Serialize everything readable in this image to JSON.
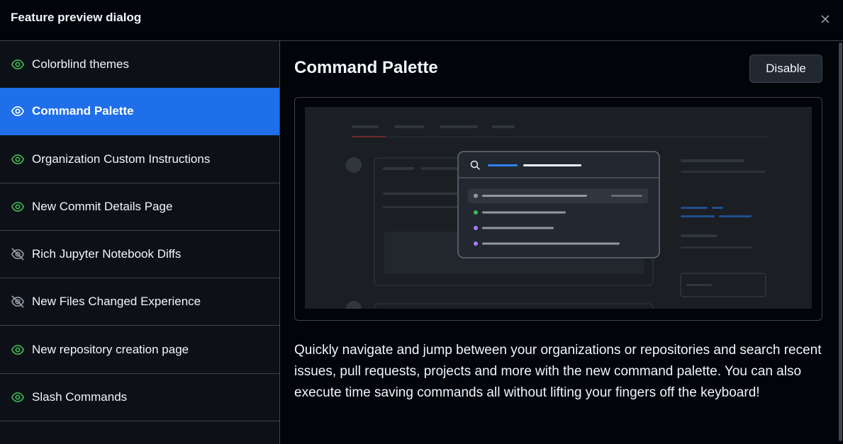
{
  "dialog": {
    "title": "Feature preview dialog",
    "close_icon": "x-icon"
  },
  "sidebar": {
    "items": [
      {
        "label": "Colorblind themes",
        "icon": "eye-icon",
        "enabled": true,
        "active": false
      },
      {
        "label": "Command Palette",
        "icon": "eye-icon",
        "enabled": true,
        "active": true
      },
      {
        "label": "Organization Custom Instructions",
        "icon": "eye-icon",
        "enabled": true,
        "active": false
      },
      {
        "label": "New Commit Details Page",
        "icon": "eye-icon",
        "enabled": true,
        "active": false
      },
      {
        "label": "Rich Jupyter Notebook Diffs",
        "icon": "eye-closed-icon",
        "enabled": false,
        "active": false
      },
      {
        "label": "New Files Changed Experience",
        "icon": "eye-closed-icon",
        "enabled": false,
        "active": false
      },
      {
        "label": "New repository creation page",
        "icon": "eye-icon",
        "enabled": true,
        "active": false
      },
      {
        "label": "Slash Commands",
        "icon": "eye-icon",
        "enabled": true,
        "active": false
      }
    ]
  },
  "main": {
    "title": "Command Palette",
    "disable_label": "Disable",
    "description": "Quickly navigate and jump between your organizations or repositories and search recent issues, pull requests, projects and more with the new command palette. You can also execute time saving commands all without lifting your fingers off the keyboard!"
  },
  "colors": {
    "accent": "#1f6feb",
    "enabled_icon": "#3fb950",
    "disabled_icon": "#9198a1",
    "border": "#3d444d"
  }
}
